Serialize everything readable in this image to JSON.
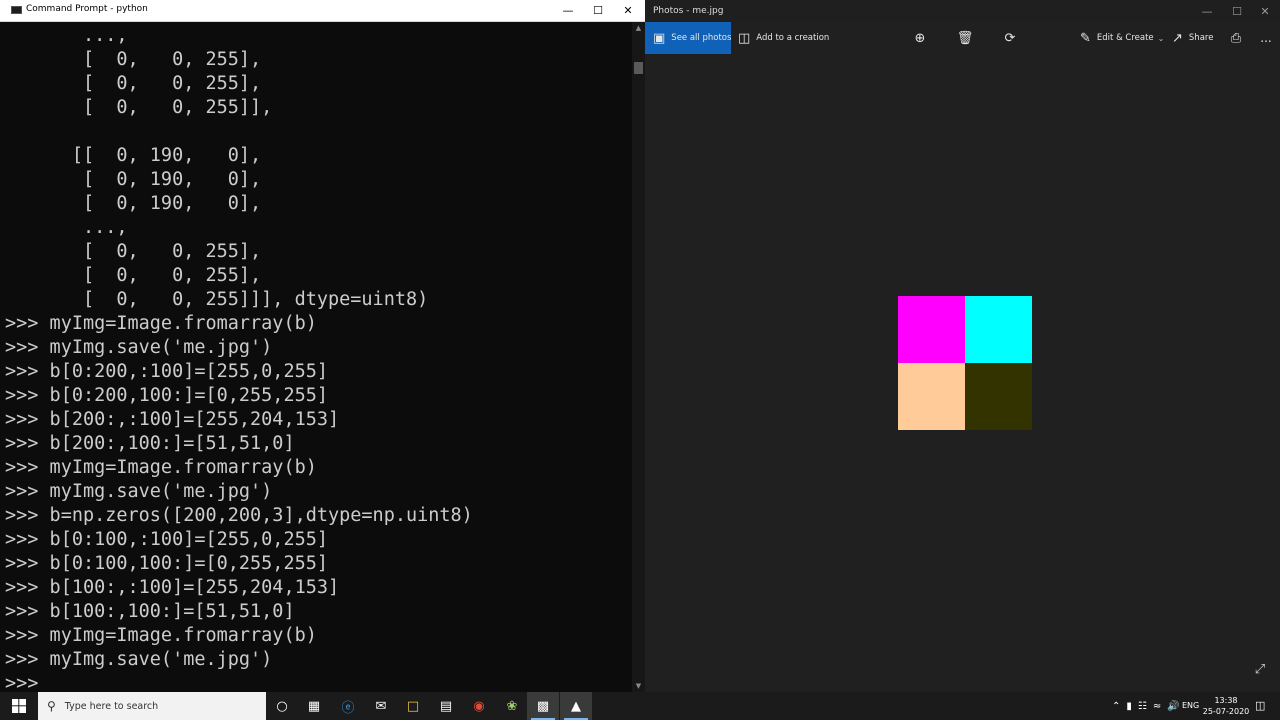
{
  "cmd": {
    "title": "Command Prompt - python",
    "lines": [
      "       ...,",
      "       [  0,   0, 255],",
      "       [  0,   0, 255],",
      "       [  0,   0, 255]],",
      "",
      "      [[  0, 190,   0],",
      "       [  0, 190,   0],",
      "       [  0, 190,   0],",
      "       ...,",
      "       [  0,   0, 255],",
      "       [  0,   0, 255],",
      "       [  0,   0, 255]]], dtype=uint8)",
      ">>> myImg=Image.fromarray(b)",
      ">>> myImg.save('me.jpg')",
      ">>> b[0:200,:100]=[255,0,255]",
      ">>> b[0:200,100:]=[0,255,255]",
      ">>> b[200:,:100]=[255,204,153]",
      ">>> b[200:,100:]=[51,51,0]",
      ">>> myImg=Image.fromarray(b)",
      ">>> myImg.save('me.jpg')",
      ">>> b=np.zeros([200,200,3],dtype=np.uint8)",
      ">>> b[0:100,:100]=[255,0,255]",
      ">>> b[0:100,100:]=[0,255,255]",
      ">>> b[100:,:100]=[255,204,153]",
      ">>> b[100:,100:]=[51,51,0]",
      ">>> myImg=Image.fromarray(b)",
      ">>> myImg.save('me.jpg')",
      ">>>"
    ]
  },
  "photos": {
    "title": "Photos - me.jpg",
    "toolbar": {
      "see_all": "See all photos",
      "add_creation": "Add to a creation",
      "edit_create": "Edit & Create",
      "share": "Share",
      "more": "..."
    },
    "image_quadrants": [
      "#ff00ff",
      "#00ffff",
      "#ffcc99",
      "#333300"
    ]
  },
  "taskbar": {
    "search_placeholder": "Type here to search",
    "language": "ENG",
    "time": "13:38",
    "date": "25-07-2020"
  }
}
